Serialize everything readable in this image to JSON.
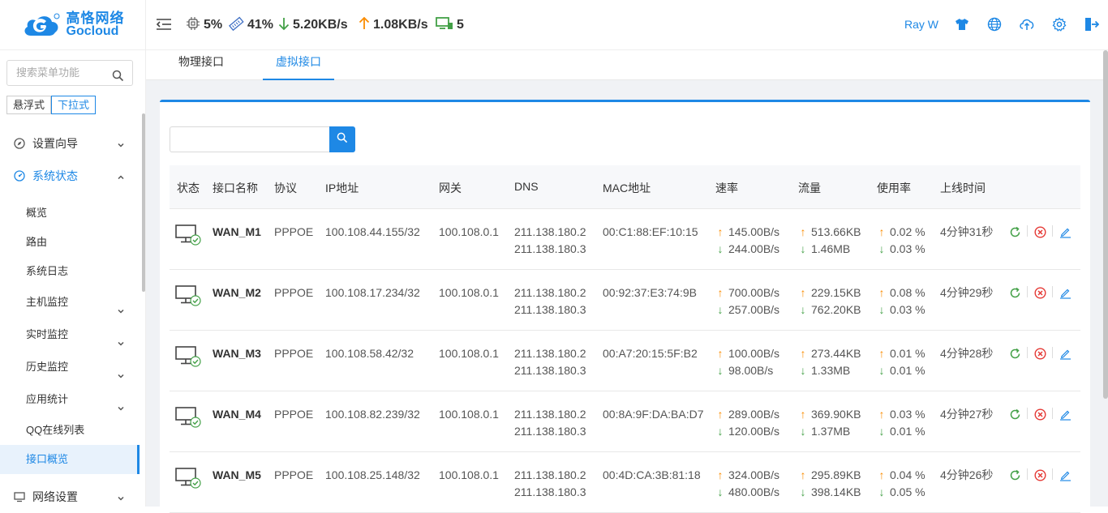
{
  "brand": {
    "name_cn": "高恪网络",
    "name_en": "Gocloud",
    "colors": {
      "primary": "#1e88e5",
      "up": "#fb8c00",
      "down": "#43a047",
      "danger": "#e53935"
    }
  },
  "sidebar": {
    "search_placeholder": "搜索菜单功能",
    "modes": [
      "悬浮式",
      "下拉式"
    ],
    "menu": [
      {
        "label": "设置向导",
        "icon": "compass-icon"
      },
      {
        "label": "系统状态",
        "icon": "dashboard-icon"
      }
    ],
    "sub_items": [
      "概览",
      "路由",
      "系统日志",
      "主机监控",
      "实时监控",
      "历史监控",
      "应用统计",
      "QQ在线列表",
      "接口概览"
    ],
    "bottom_item": {
      "label": "网络设置",
      "icon": "monitor-icon"
    }
  },
  "header": {
    "cpu": "5%",
    "memory": "41%",
    "download": "5.20KB/s",
    "upload": "1.08KB/s",
    "hosts": "5",
    "user": "Ray W"
  },
  "tabs": [
    "物理接口",
    "虚拟接口"
  ],
  "table": {
    "headers": [
      "状态",
      "接口名称",
      "协议",
      "IP地址",
      "网关",
      "DNS",
      "MAC地址",
      "速率",
      "流量",
      "使用率",
      "上线时间"
    ],
    "rows": [
      {
        "name": "WAN_M1",
        "protocol": "PPPOE",
        "ip": "100.108.44.155/32",
        "gateway": "100.108.0.1",
        "dns1": "211.138.180.2",
        "dns2": "211.138.180.3",
        "mac": "00:C1:88:EF:10:15",
        "rate_up": "145.00B/s",
        "rate_down": "244.00B/s",
        "flow_up": "513.66KB",
        "flow_down": "1.46MB",
        "usage_up": "0.02 %",
        "usage_down": "0.03 %",
        "uptime": "4分钟31秒"
      },
      {
        "name": "WAN_M2",
        "protocol": "PPPOE",
        "ip": "100.108.17.234/32",
        "gateway": "100.108.0.1",
        "dns1": "211.138.180.2",
        "dns2": "211.138.180.3",
        "mac": "00:92:37:E3:74:9B",
        "rate_up": "700.00B/s",
        "rate_down": "257.00B/s",
        "flow_up": "229.15KB",
        "flow_down": "762.20KB",
        "usage_up": "0.08 %",
        "usage_down": "0.03 %",
        "uptime": "4分钟29秒"
      },
      {
        "name": "WAN_M3",
        "protocol": "PPPOE",
        "ip": "100.108.58.42/32",
        "gateway": "100.108.0.1",
        "dns1": "211.138.180.2",
        "dns2": "211.138.180.3",
        "mac": "00:A7:20:15:5F:B2",
        "rate_up": "100.00B/s",
        "rate_down": "98.00B/s",
        "flow_up": "273.44KB",
        "flow_down": "1.33MB",
        "usage_up": "0.01 %",
        "usage_down": "0.01 %",
        "uptime": "4分钟28秒"
      },
      {
        "name": "WAN_M4",
        "protocol": "PPPOE",
        "ip": "100.108.82.239/32",
        "gateway": "100.108.0.1",
        "dns1": "211.138.180.2",
        "dns2": "211.138.180.3",
        "mac": "00:8A:9F:DA:BA:D7",
        "rate_up": "289.00B/s",
        "rate_down": "120.00B/s",
        "flow_up": "369.90KB",
        "flow_down": "1.37MB",
        "usage_up": "0.03 %",
        "usage_down": "0.01 %",
        "uptime": "4分钟27秒"
      },
      {
        "name": "WAN_M5",
        "protocol": "PPPOE",
        "ip": "100.108.25.148/32",
        "gateway": "100.108.0.1",
        "dns1": "211.138.180.2",
        "dns2": "211.138.180.3",
        "mac": "00:4D:CA:3B:81:18",
        "rate_up": "324.00B/s",
        "rate_down": "480.00B/s",
        "flow_up": "295.89KB",
        "flow_down": "398.14KB",
        "usage_up": "0.04 %",
        "usage_down": "0.05 %",
        "uptime": "4分钟26秒"
      }
    ]
  }
}
